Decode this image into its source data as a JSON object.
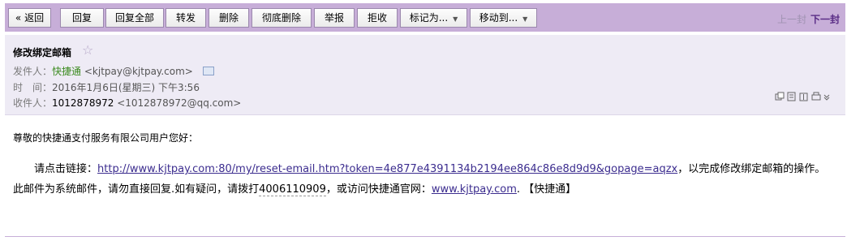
{
  "toolbar": {
    "back": "« 返回",
    "reply": "回复",
    "reply_all": "回复全部",
    "forward": "转发",
    "delete": "删除",
    "delete_permanent": "彻底删除",
    "report": "举报",
    "reject": "拒收",
    "mark_as": "标记为...",
    "move_to": "移动到...",
    "prev": "上一封",
    "next": "下一封"
  },
  "mail": {
    "subject": "修改绑定邮箱",
    "from_label": "发件人：",
    "from_name": "快捷通",
    "from_email": "<kjtpay@kjtpay.com>",
    "time_label": "时　间：",
    "time_value": "2016年1月6日(星期三) 下午3:56",
    "to_label": "收件人：",
    "to_name": "1012878972",
    "to_email": "<1012878972@qq.com>"
  },
  "body": {
    "greeting": "尊敬的快捷通支付服务有限公司用户您好：",
    "click_prefix": "请点击链接：",
    "reset_link": "http://www.kjtpay.com:80/my/reset-email.htm?token=4e877e4391134b2194ee864c86e8d9d9&gopage=aqzx",
    "after_link": "，以完成修改绑定邮箱的操作。此邮件为系统邮件，请勿直接回复.如有疑问，请拨打",
    "phone": "4006110909",
    "visit_text": "，或访问快捷通官网：",
    "site_link": "www.kjtpay.com",
    "signature": ". 【快捷通】"
  },
  "icons": {
    "star": "star-icon",
    "contact": "contact-card-icon",
    "view": "view-options-icons"
  },
  "colors": {
    "toolbar_bg": "#c7aed8",
    "header_bg": "#eeebf5",
    "link": "#3c2d8f",
    "sender": "#3a8a1e"
  }
}
